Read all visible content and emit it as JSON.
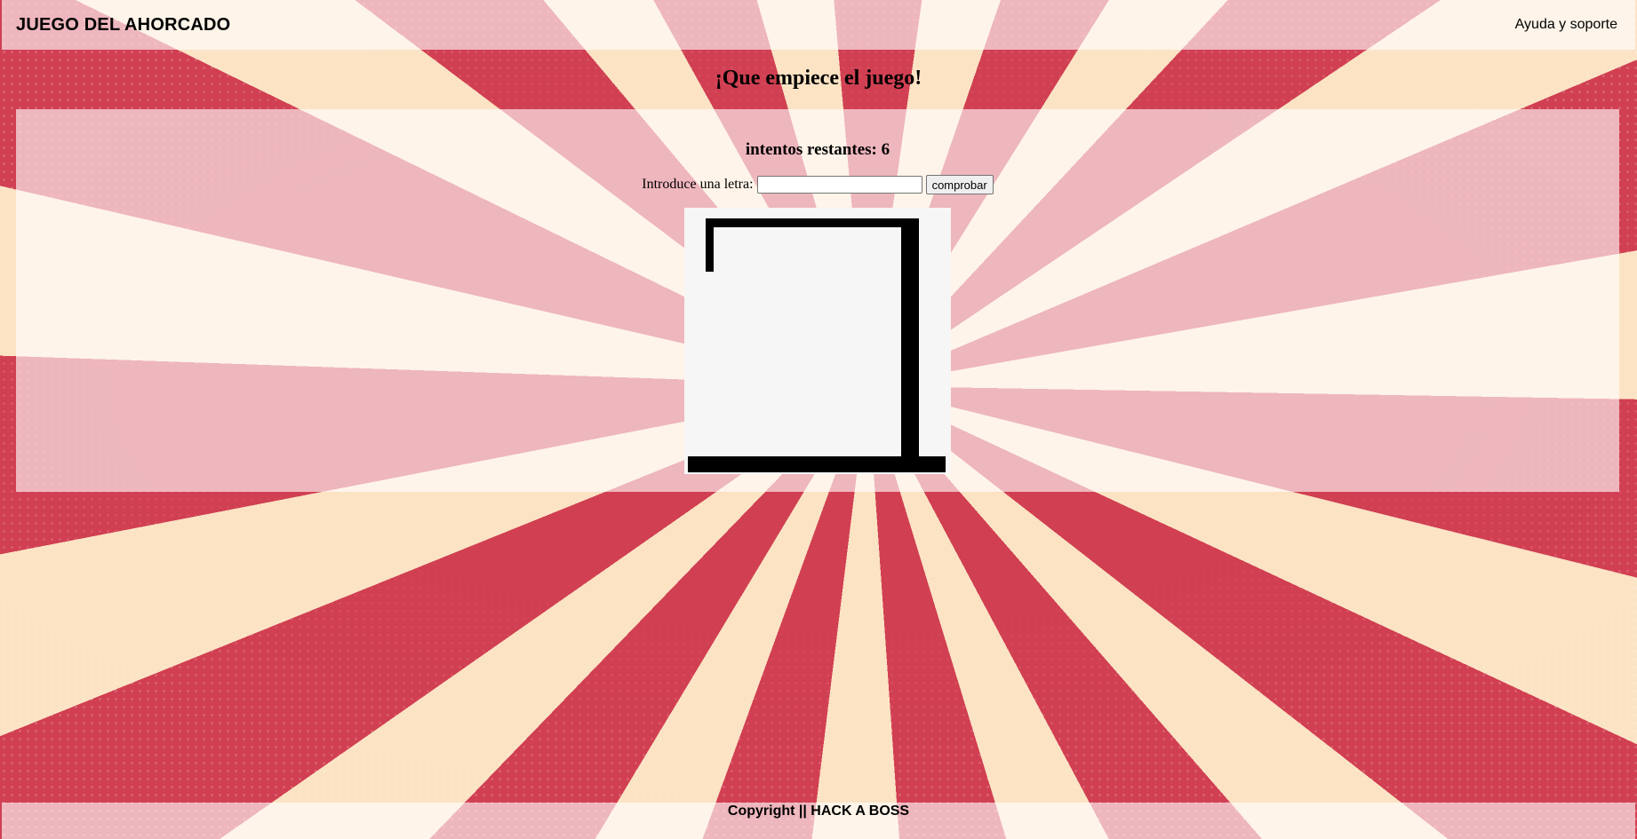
{
  "header": {
    "brand": "JUEGO DEL AHORCADO",
    "help_link": "Ayuda y soporte"
  },
  "main": {
    "title": "¡Que empiece el juego!",
    "attempts_text": "intentos restantes: 6",
    "guess_label": "Introduce una letra:",
    "guess_value": "",
    "check_button": "comprobar"
  },
  "footer": {
    "copyright": "Copyright || HACK A BOSS"
  },
  "colors": {
    "background_red": "#d13f52",
    "background_cream": "#fbe3c4",
    "panel_overlay": "#ffffff",
    "canvas_bg": "#f6f6f6",
    "gallows": "#000000"
  }
}
